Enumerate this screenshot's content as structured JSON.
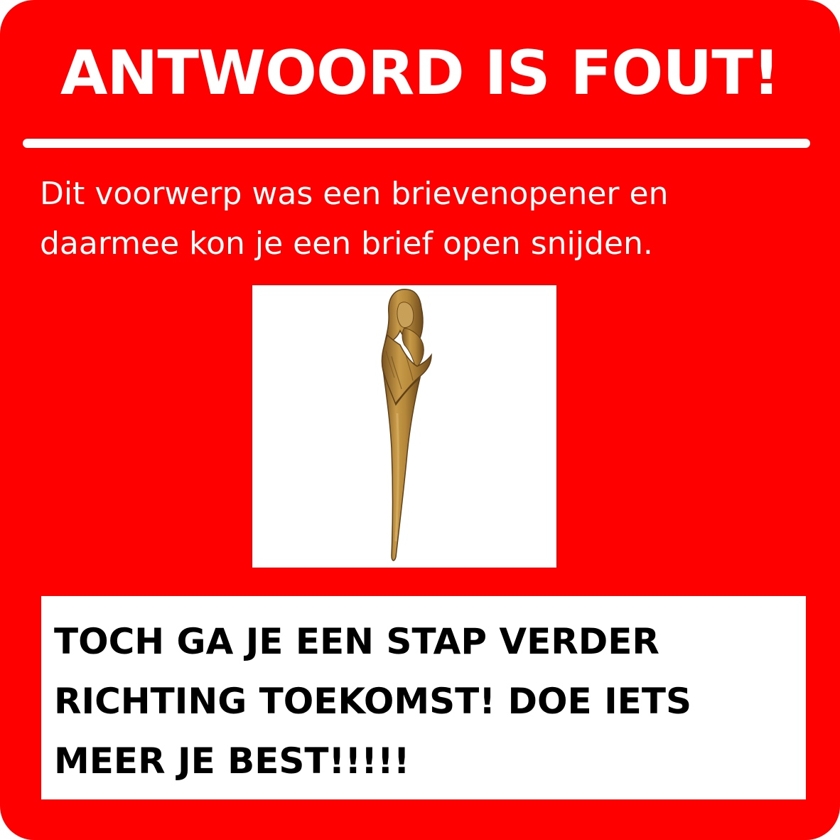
{
  "title": "ANTWOORD IS FOUT!",
  "explanation": {
    "line1": "Dit voorwerp was een brievenopener en",
    "line2": "daarmee kon je een brief open snijden."
  },
  "image": {
    "icon": "letter-opener-figure-icon"
  },
  "message": {
    "line1": "TOCH GA JE EEN STAP VERDER",
    "line2": "RICHTING TOEKOMST! DOE IETS",
    "line3": "MEER JE BEST!!!!!"
  },
  "colors": {
    "background": "#ff0000",
    "text_light": "#ffffff",
    "text_dark": "#000000",
    "bronze": "#b5883a"
  }
}
